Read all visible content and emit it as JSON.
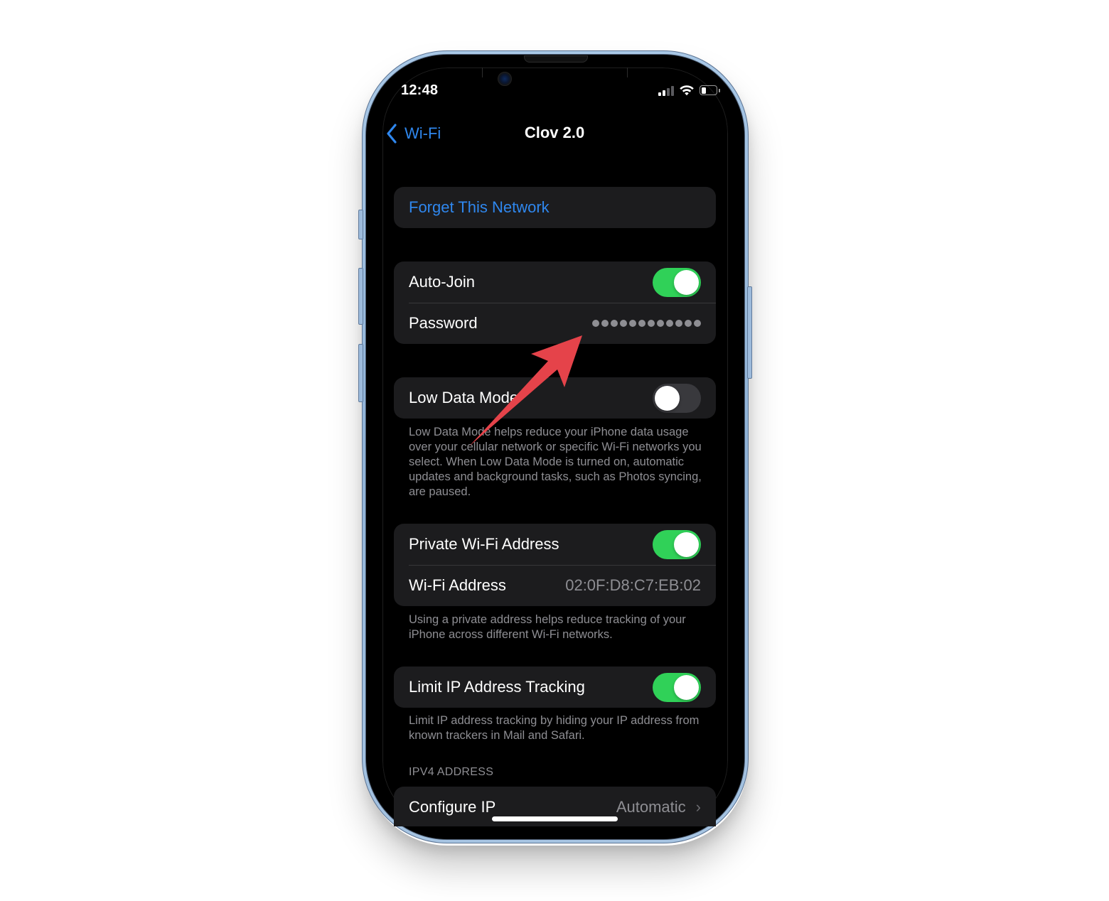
{
  "status_bar": {
    "time": "12:48",
    "signal_bars_active": 2,
    "signal_bars_total": 4,
    "battery_level_percent": 35,
    "icons": [
      "cellular-signal-icon",
      "wifi-icon",
      "battery-icon"
    ]
  },
  "nav": {
    "back_label": "Wi-Fi",
    "back_icon": "chevron-left-icon",
    "title": "Clov 2.0"
  },
  "forget_group": {
    "forget_label": "Forget This Network"
  },
  "join_group": {
    "auto_join_label": "Auto-Join",
    "auto_join_on": true,
    "password_label": "Password",
    "password_mask_count": 12
  },
  "low_data_group": {
    "label": "Low Data Mode",
    "on": false,
    "footer": "Low Data Mode helps reduce your iPhone data usage over your cellular network or specific Wi-Fi networks you select. When Low Data Mode is turned on, automatic updates and background tasks, such as Photos syncing, are paused."
  },
  "private_group": {
    "private_label": "Private Wi-Fi Address",
    "private_on": true,
    "address_label": "Wi-Fi Address",
    "address_value": "02:0F:D8:C7:EB:02",
    "footer": "Using a private address helps reduce tracking of your iPhone across different Wi-Fi networks."
  },
  "limit_group": {
    "label": "Limit IP Address Tracking",
    "on": true,
    "footer": "Limit IP address tracking by hiding your IP address from known trackers in Mail and Safari."
  },
  "ipv4_group": {
    "header": "IPV4 ADDRESS",
    "configure_label": "Configure IP",
    "configure_value": "Automatic",
    "chevron": "›"
  },
  "annotation": {
    "type": "arrow",
    "color": "#e5434a",
    "points_to": "password-value"
  },
  "colors": {
    "accent_blue": "#2f87ee",
    "toggle_on": "#30d158",
    "toggle_off": "#39393d",
    "cell_bg": "#1c1c1e",
    "secondary_text": "#8e8e93",
    "phone_frame": "#a9c8e6"
  }
}
